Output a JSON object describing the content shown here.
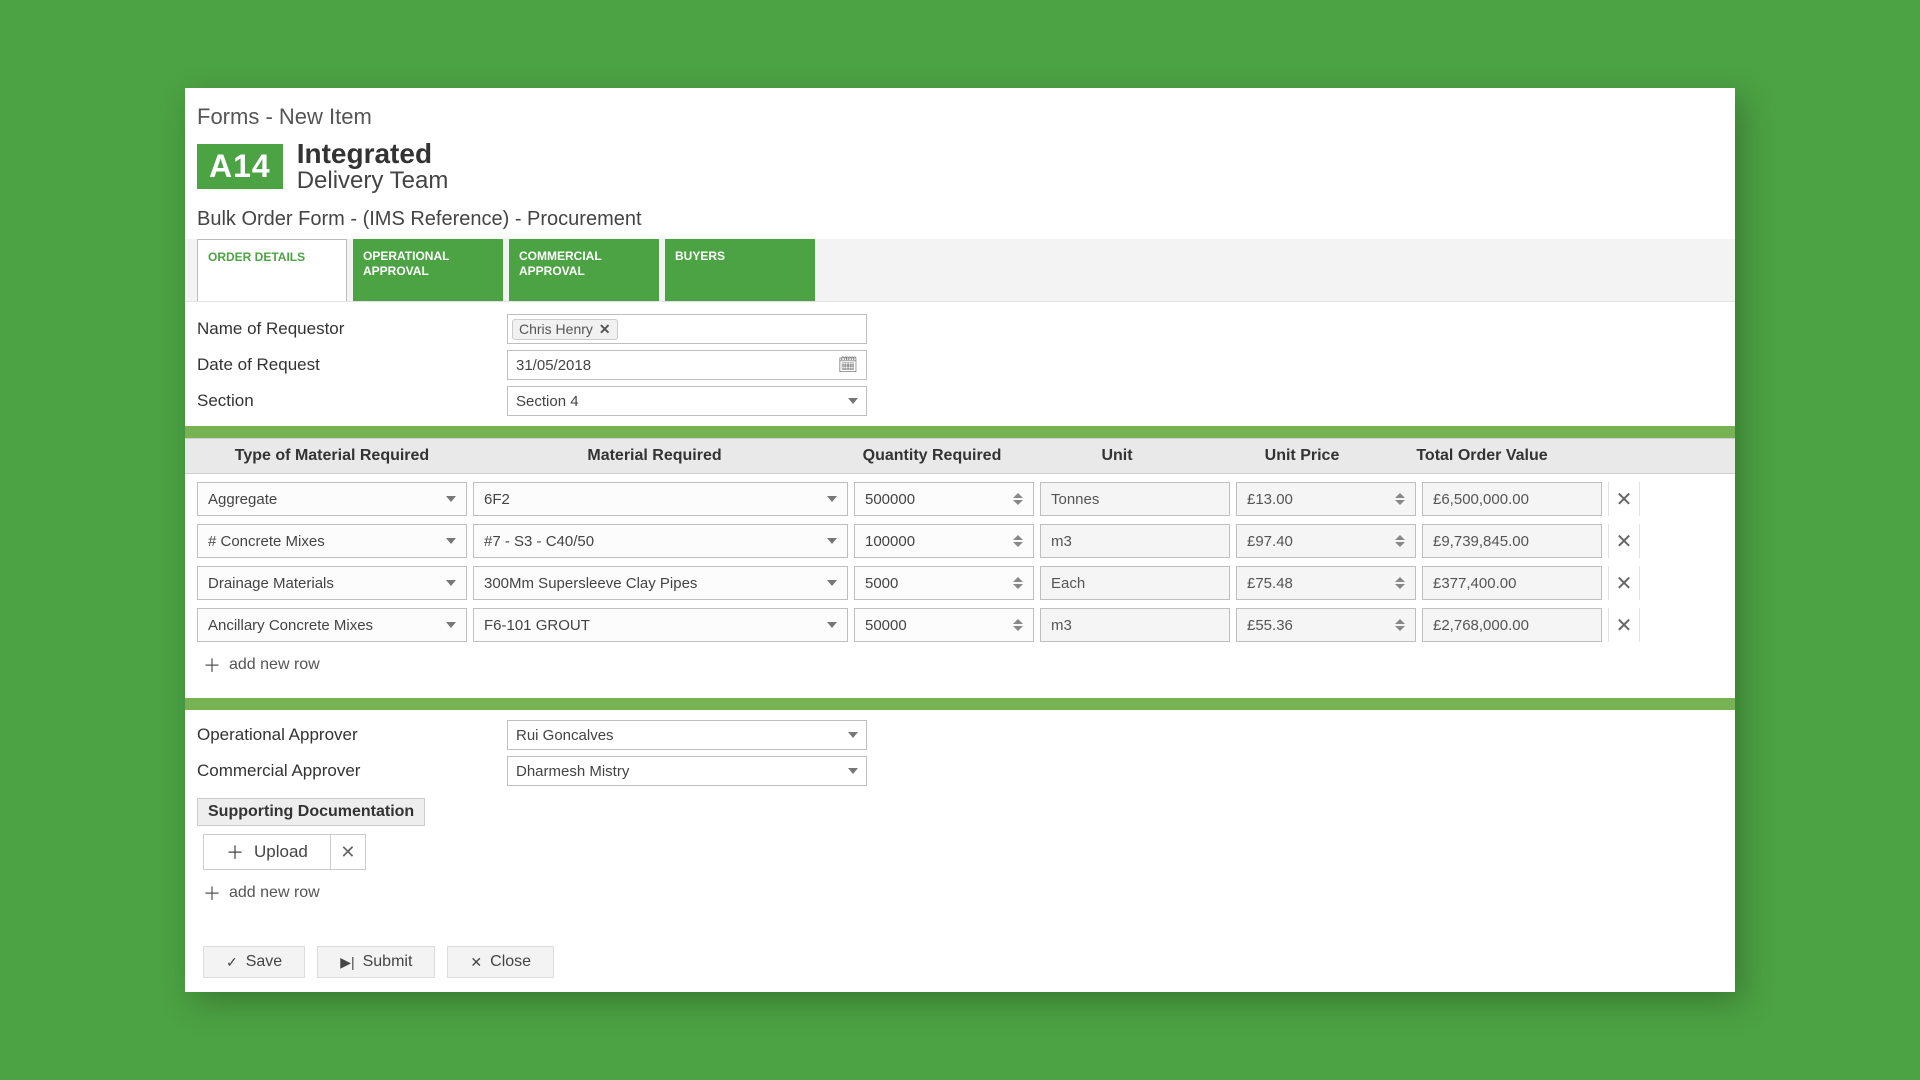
{
  "breadcrumb": "Forms - New Item",
  "brand": {
    "badge": "A14",
    "line1": "Integrated",
    "line2": "Delivery Team"
  },
  "form_title": "Bulk Order Form - (IMS Reference) - Procurement",
  "tabs": [
    {
      "label": "ORDER DETAILS",
      "active": true
    },
    {
      "label": "OPERATIONAL APPROVAL",
      "active": false
    },
    {
      "label": "COMMERCIAL APPROVAL",
      "active": false
    },
    {
      "label": "BUYERS",
      "active": false
    }
  ],
  "fields": {
    "requestor_label": "Name of Requestor",
    "requestor_value": "Chris Henry",
    "date_label": "Date of Request",
    "date_value": "31/05/2018",
    "section_label": "Section",
    "section_value": "Section 4"
  },
  "table": {
    "headers": {
      "type": "Type of Material Required",
      "material": "Material Required",
      "qty": "Quantity Required",
      "unit": "Unit",
      "price": "Unit Price",
      "total": "Total Order Value"
    },
    "rows": [
      {
        "type": "Aggregate",
        "material": "6F2",
        "qty": "500000",
        "unit": "Tonnes",
        "price": "£13.00",
        "total": "£6,500,000.00"
      },
      {
        "type": "# Concrete Mixes",
        "material": "#7 - S3 - C40/50",
        "qty": "100000",
        "unit": "m3",
        "price": "£97.40",
        "total": "£9,739,845.00"
      },
      {
        "type": "Drainage Materials",
        "material": "300Mm Supersleeve Clay Pipes",
        "qty": "5000",
        "unit": "Each",
        "price": "£75.48",
        "total": "£377,400.00"
      },
      {
        "type": "Ancillary Concrete Mixes",
        "material": "F6-101 GROUT",
        "qty": "50000",
        "unit": "m3",
        "price": "£55.36",
        "total": "£2,768,000.00"
      }
    ],
    "add_row_label": "add new row"
  },
  "approvers": {
    "operational_label": "Operational Approver",
    "operational_value": "Rui Goncalves",
    "commercial_label": "Commercial Approver",
    "commercial_value": "Dharmesh Mistry"
  },
  "docs": {
    "header": "Supporting Documentation",
    "upload_label": "Upload",
    "add_row_label": "add new row"
  },
  "actions": {
    "save": "Save",
    "submit": "Submit",
    "close": "Close"
  }
}
